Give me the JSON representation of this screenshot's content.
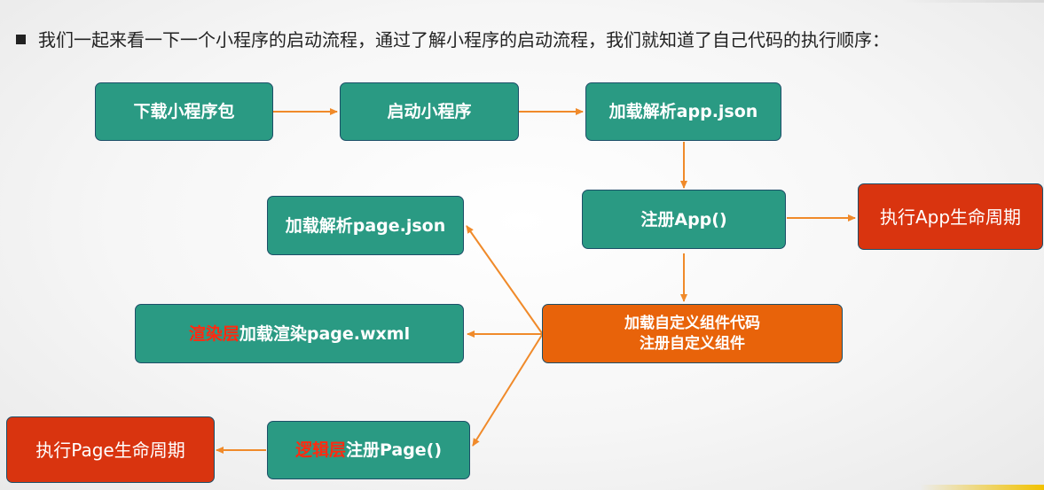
{
  "header": {
    "intro": "我们一起来看一下一个小程序的启动流程，通过了解小程序的启动流程，我们就知道了自己代码的执行顺序："
  },
  "nodes": {
    "download": "下载小程序包",
    "launch": "启动小程序",
    "parse_app_json": "加载解析app.json",
    "register_app": "注册App()",
    "app_lifecycle": "执行App生命周期",
    "custom_components_line1": "加载自定义组件代码",
    "custom_components_line2": "注册自定义组件",
    "parse_page_json": "加载解析page.json",
    "render_prefix": "渲染层",
    "render_suffix": "加载渲染page.wxml",
    "logic_prefix": "逻辑层",
    "logic_suffix": "注册Page()",
    "page_lifecycle": "执行Page生命周期"
  },
  "colors": {
    "teal": "#2a9a83",
    "orange": "#e8630a",
    "red": "#d9340f",
    "arrow": "#f08a2a",
    "highlight_text": "#ff2a10"
  }
}
